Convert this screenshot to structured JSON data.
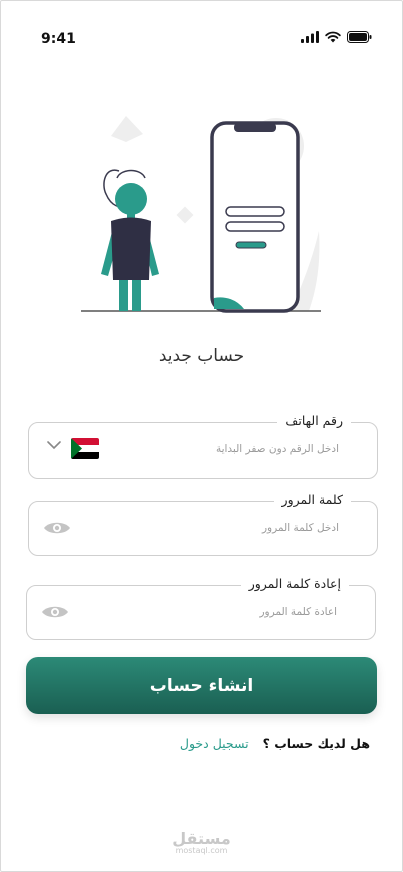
{
  "status_bar": {
    "time": "9:41"
  },
  "colors": {
    "accent": "#2a9b8b",
    "button_top": "#2c8a77",
    "button_bottom": "#1a5f52"
  },
  "title": "حساب جديد",
  "phone_field": {
    "label": "رقم الهاتف",
    "placeholder": "ادخل الرقم دون صفر البداية",
    "country_flag": "sudan-flag-icon"
  },
  "password_field": {
    "label": "كلمة المرور",
    "placeholder": "ادخل كلمة المرور"
  },
  "confirm_field": {
    "label": "إعادة كلمة المرور",
    "placeholder": "اعادة كلمة المرور"
  },
  "create_button": {
    "label": "انشاء حساب"
  },
  "account_prompt": {
    "question": "هل لديك حساب ؟",
    "login_link": "تسجيل دخول"
  },
  "watermark": {
    "brand": "مستقل",
    "domain": "mostaql.com"
  }
}
